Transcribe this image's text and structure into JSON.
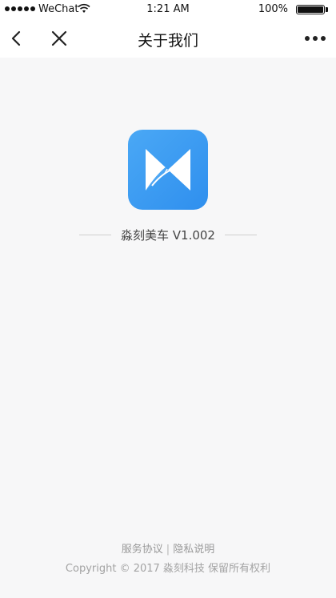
{
  "status_bar": {
    "carrier": "WeChat",
    "time": "1:21 AM",
    "battery": "100%",
    "battery_level": 1.0
  },
  "nav": {
    "title": "关于我们",
    "back_icon": "chevron-left-icon",
    "close_icon": "close-icon",
    "more_icon": "more-icon"
  },
  "app": {
    "icon": "app-logo-icon",
    "brand_color": "#3a9cf2",
    "version_text": "淼刻美车 V1.002"
  },
  "footer": {
    "service_agreement": "服务协议",
    "separator": "|",
    "privacy_policy": "隐私说明",
    "copyright": "Copyright © 2017 淼刻科技 保留所有权利"
  }
}
